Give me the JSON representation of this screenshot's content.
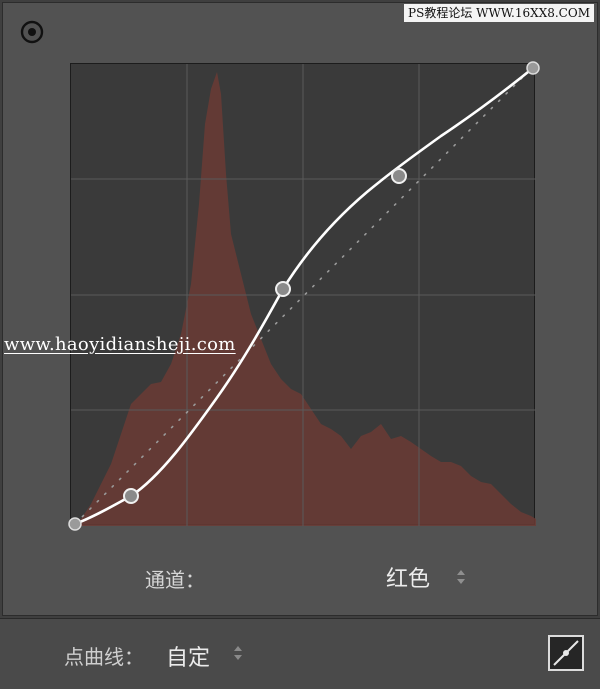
{
  "header": {
    "watermark_top": "PS教程论坛 WWW.16XX8.COM",
    "target_icon": "target-icon"
  },
  "curve_editor": {
    "channel_color": "#c2362c",
    "curve_color": "#ffffff",
    "histogram_color": "#6b3b35",
    "watermark_mid": "www.haoyidiansheji.com"
  },
  "channel": {
    "label": "通道：",
    "value": "红色"
  },
  "point_curve": {
    "label": "点曲线：",
    "value": "自定"
  },
  "icons": {
    "channel_stepper": "up-down-stepper-icon",
    "preset_stepper": "up-down-stepper-icon",
    "curve_toggle": "point-curve-icon"
  }
}
